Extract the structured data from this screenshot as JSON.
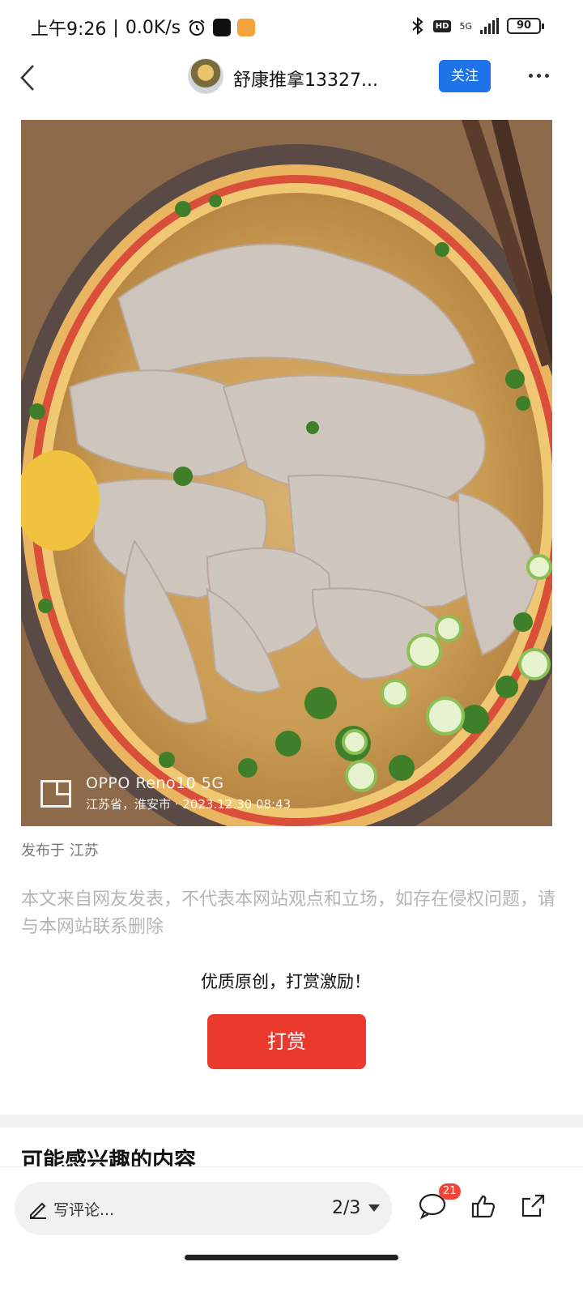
{
  "status_bar": {
    "time": "上午9:26",
    "net_speed": "0.0K/s",
    "network": "5G",
    "hd": "HD",
    "battery": "90"
  },
  "header": {
    "author_name": "舒康推拿13327...",
    "follow_label": "关注"
  },
  "photo": {
    "watermark_device": "OPPO Reno10 5G",
    "watermark_location": "江苏省，淮安市 · 2023.12.30 08:43"
  },
  "post": {
    "publish_location": "发布于 江苏",
    "disclaimer": "本文来自网友发表，不代表本网站观点和立场，如存在侵权问题，请与本网站联系删除",
    "reward_prompt": "优质原创，打赏激励！",
    "reward_button": "打赏"
  },
  "recommend": {
    "section_title": "可能感兴趣的内容"
  },
  "bottom_bar": {
    "comment_placeholder": "写评论...",
    "page_indicator": "2/3",
    "comment_count": "21"
  },
  "colors": {
    "follow_blue": "#1e73e8",
    "reward_red": "#ea3a2e",
    "badge_red": "#f0453a"
  }
}
